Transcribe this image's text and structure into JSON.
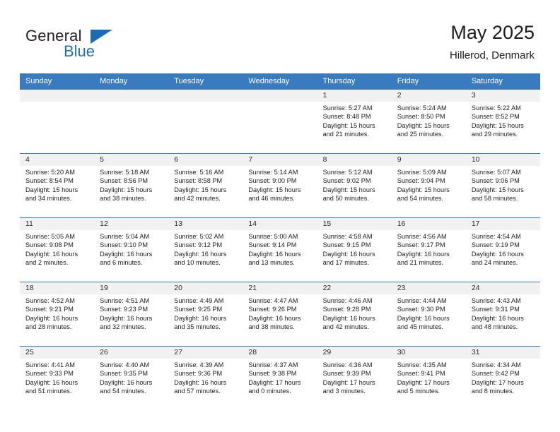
{
  "brand": {
    "name_primary": "General",
    "name_secondary": "Blue",
    "accent_color": "#1a6cb5"
  },
  "header": {
    "title": "May 2025",
    "location": "Hillerod, Denmark",
    "header_bg_color": "#3a7bbf"
  },
  "weekday_headers": [
    "Sunday",
    "Monday",
    "Tuesday",
    "Wednesday",
    "Thursday",
    "Friday",
    "Saturday"
  ],
  "weeks": [
    [
      {
        "day": "",
        "sunrise": "",
        "sunset": "",
        "daylight_line1": "",
        "daylight_line2": "",
        "empty": true
      },
      {
        "day": "",
        "sunrise": "",
        "sunset": "",
        "daylight_line1": "",
        "daylight_line2": "",
        "empty": true
      },
      {
        "day": "",
        "sunrise": "",
        "sunset": "",
        "daylight_line1": "",
        "daylight_line2": "",
        "empty": true
      },
      {
        "day": "",
        "sunrise": "",
        "sunset": "",
        "daylight_line1": "",
        "daylight_line2": "",
        "empty": true
      },
      {
        "day": "1",
        "sunrise": "Sunrise: 5:27 AM",
        "sunset": "Sunset: 8:48 PM",
        "daylight_line1": "Daylight: 15 hours",
        "daylight_line2": "and 21 minutes.",
        "empty": false
      },
      {
        "day": "2",
        "sunrise": "Sunrise: 5:24 AM",
        "sunset": "Sunset: 8:50 PM",
        "daylight_line1": "Daylight: 15 hours",
        "daylight_line2": "and 25 minutes.",
        "empty": false
      },
      {
        "day": "3",
        "sunrise": "Sunrise: 5:22 AM",
        "sunset": "Sunset: 8:52 PM",
        "daylight_line1": "Daylight: 15 hours",
        "daylight_line2": "and 29 minutes.",
        "empty": false
      }
    ],
    [
      {
        "day": "4",
        "sunrise": "Sunrise: 5:20 AM",
        "sunset": "Sunset: 8:54 PM",
        "daylight_line1": "Daylight: 15 hours",
        "daylight_line2": "and 34 minutes.",
        "empty": false
      },
      {
        "day": "5",
        "sunrise": "Sunrise: 5:18 AM",
        "sunset": "Sunset: 8:56 PM",
        "daylight_line1": "Daylight: 15 hours",
        "daylight_line2": "and 38 minutes.",
        "empty": false
      },
      {
        "day": "6",
        "sunrise": "Sunrise: 5:16 AM",
        "sunset": "Sunset: 8:58 PM",
        "daylight_line1": "Daylight: 15 hours",
        "daylight_line2": "and 42 minutes.",
        "empty": false
      },
      {
        "day": "7",
        "sunrise": "Sunrise: 5:14 AM",
        "sunset": "Sunset: 9:00 PM",
        "daylight_line1": "Daylight: 15 hours",
        "daylight_line2": "and 46 minutes.",
        "empty": false
      },
      {
        "day": "8",
        "sunrise": "Sunrise: 5:12 AM",
        "sunset": "Sunset: 9:02 PM",
        "daylight_line1": "Daylight: 15 hours",
        "daylight_line2": "and 50 minutes.",
        "empty": false
      },
      {
        "day": "9",
        "sunrise": "Sunrise: 5:09 AM",
        "sunset": "Sunset: 9:04 PM",
        "daylight_line1": "Daylight: 15 hours",
        "daylight_line2": "and 54 minutes.",
        "empty": false
      },
      {
        "day": "10",
        "sunrise": "Sunrise: 5:07 AM",
        "sunset": "Sunset: 9:06 PM",
        "daylight_line1": "Daylight: 15 hours",
        "daylight_line2": "and 58 minutes.",
        "empty": false
      }
    ],
    [
      {
        "day": "11",
        "sunrise": "Sunrise: 5:05 AM",
        "sunset": "Sunset: 9:08 PM",
        "daylight_line1": "Daylight: 16 hours",
        "daylight_line2": "and 2 minutes.",
        "empty": false
      },
      {
        "day": "12",
        "sunrise": "Sunrise: 5:04 AM",
        "sunset": "Sunset: 9:10 PM",
        "daylight_line1": "Daylight: 16 hours",
        "daylight_line2": "and 6 minutes.",
        "empty": false
      },
      {
        "day": "13",
        "sunrise": "Sunrise: 5:02 AM",
        "sunset": "Sunset: 9:12 PM",
        "daylight_line1": "Daylight: 16 hours",
        "daylight_line2": "and 10 minutes.",
        "empty": false
      },
      {
        "day": "14",
        "sunrise": "Sunrise: 5:00 AM",
        "sunset": "Sunset: 9:14 PM",
        "daylight_line1": "Daylight: 16 hours",
        "daylight_line2": "and 13 minutes.",
        "empty": false
      },
      {
        "day": "15",
        "sunrise": "Sunrise: 4:58 AM",
        "sunset": "Sunset: 9:15 PM",
        "daylight_line1": "Daylight: 16 hours",
        "daylight_line2": "and 17 minutes.",
        "empty": false
      },
      {
        "day": "16",
        "sunrise": "Sunrise: 4:56 AM",
        "sunset": "Sunset: 9:17 PM",
        "daylight_line1": "Daylight: 16 hours",
        "daylight_line2": "and 21 minutes.",
        "empty": false
      },
      {
        "day": "17",
        "sunrise": "Sunrise: 4:54 AM",
        "sunset": "Sunset: 9:19 PM",
        "daylight_line1": "Daylight: 16 hours",
        "daylight_line2": "and 24 minutes.",
        "empty": false
      }
    ],
    [
      {
        "day": "18",
        "sunrise": "Sunrise: 4:52 AM",
        "sunset": "Sunset: 9:21 PM",
        "daylight_line1": "Daylight: 16 hours",
        "daylight_line2": "and 28 minutes.",
        "empty": false
      },
      {
        "day": "19",
        "sunrise": "Sunrise: 4:51 AM",
        "sunset": "Sunset: 9:23 PM",
        "daylight_line1": "Daylight: 16 hours",
        "daylight_line2": "and 32 minutes.",
        "empty": false
      },
      {
        "day": "20",
        "sunrise": "Sunrise: 4:49 AM",
        "sunset": "Sunset: 9:25 PM",
        "daylight_line1": "Daylight: 16 hours",
        "daylight_line2": "and 35 minutes.",
        "empty": false
      },
      {
        "day": "21",
        "sunrise": "Sunrise: 4:47 AM",
        "sunset": "Sunset: 9:26 PM",
        "daylight_line1": "Daylight: 16 hours",
        "daylight_line2": "and 38 minutes.",
        "empty": false
      },
      {
        "day": "22",
        "sunrise": "Sunrise: 4:46 AM",
        "sunset": "Sunset: 9:28 PM",
        "daylight_line1": "Daylight: 16 hours",
        "daylight_line2": "and 42 minutes.",
        "empty": false
      },
      {
        "day": "23",
        "sunrise": "Sunrise: 4:44 AM",
        "sunset": "Sunset: 9:30 PM",
        "daylight_line1": "Daylight: 16 hours",
        "daylight_line2": "and 45 minutes.",
        "empty": false
      },
      {
        "day": "24",
        "sunrise": "Sunrise: 4:43 AM",
        "sunset": "Sunset: 9:31 PM",
        "daylight_line1": "Daylight: 16 hours",
        "daylight_line2": "and 48 minutes.",
        "empty": false
      }
    ],
    [
      {
        "day": "25",
        "sunrise": "Sunrise: 4:41 AM",
        "sunset": "Sunset: 9:33 PM",
        "daylight_line1": "Daylight: 16 hours",
        "daylight_line2": "and 51 minutes.",
        "empty": false
      },
      {
        "day": "26",
        "sunrise": "Sunrise: 4:40 AM",
        "sunset": "Sunset: 9:35 PM",
        "daylight_line1": "Daylight: 16 hours",
        "daylight_line2": "and 54 minutes.",
        "empty": false
      },
      {
        "day": "27",
        "sunrise": "Sunrise: 4:39 AM",
        "sunset": "Sunset: 9:36 PM",
        "daylight_line1": "Daylight: 16 hours",
        "daylight_line2": "and 57 minutes.",
        "empty": false
      },
      {
        "day": "28",
        "sunrise": "Sunrise: 4:37 AM",
        "sunset": "Sunset: 9:38 PM",
        "daylight_line1": "Daylight: 17 hours",
        "daylight_line2": "and 0 minutes.",
        "empty": false
      },
      {
        "day": "29",
        "sunrise": "Sunrise: 4:36 AM",
        "sunset": "Sunset: 9:39 PM",
        "daylight_line1": "Daylight: 17 hours",
        "daylight_line2": "and 3 minutes.",
        "empty": false
      },
      {
        "day": "30",
        "sunrise": "Sunrise: 4:35 AM",
        "sunset": "Sunset: 9:41 PM",
        "daylight_line1": "Daylight: 17 hours",
        "daylight_line2": "and 5 minutes.",
        "empty": false
      },
      {
        "day": "31",
        "sunrise": "Sunrise: 4:34 AM",
        "sunset": "Sunset: 9:42 PM",
        "daylight_line1": "Daylight: 17 hours",
        "daylight_line2": "and 8 minutes.",
        "empty": false
      }
    ]
  ]
}
